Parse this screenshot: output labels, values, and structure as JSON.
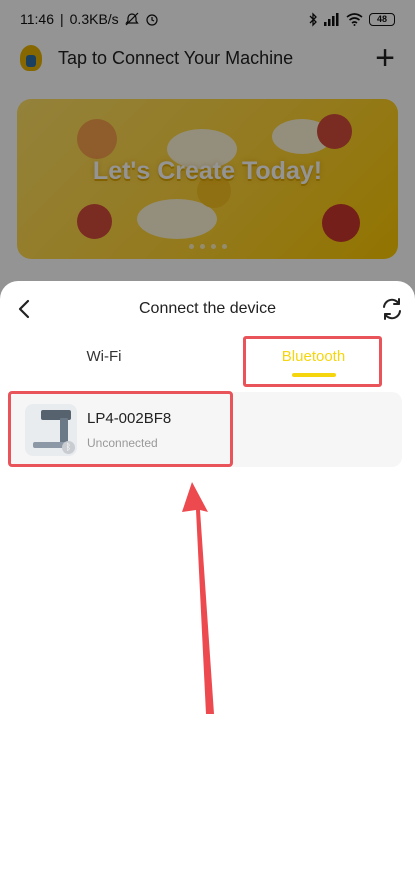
{
  "status_bar": {
    "time": "11:46",
    "net_speed": "0.3KB/s",
    "battery": "48"
  },
  "app": {
    "header_title": "Tap to Connect Your Machine",
    "banner_text": "Let's Create Today!"
  },
  "sheet": {
    "title": "Connect the device",
    "tabs": [
      {
        "label": "Wi-Fi",
        "active": false
      },
      {
        "label": "Bluetooth",
        "active": true
      }
    ],
    "devices": [
      {
        "name": "LP4-002BF8",
        "status": "Unconnected"
      }
    ]
  },
  "colors": {
    "accent": "#f5d60e",
    "highlight": "#e8545a",
    "overlay": "rgba(0,0,0,0.42)"
  },
  "icons": [
    "back-icon",
    "refresh-icon",
    "plus-icon",
    "bluetooth-icon",
    "wifi-icon",
    "alarm-icon"
  ]
}
